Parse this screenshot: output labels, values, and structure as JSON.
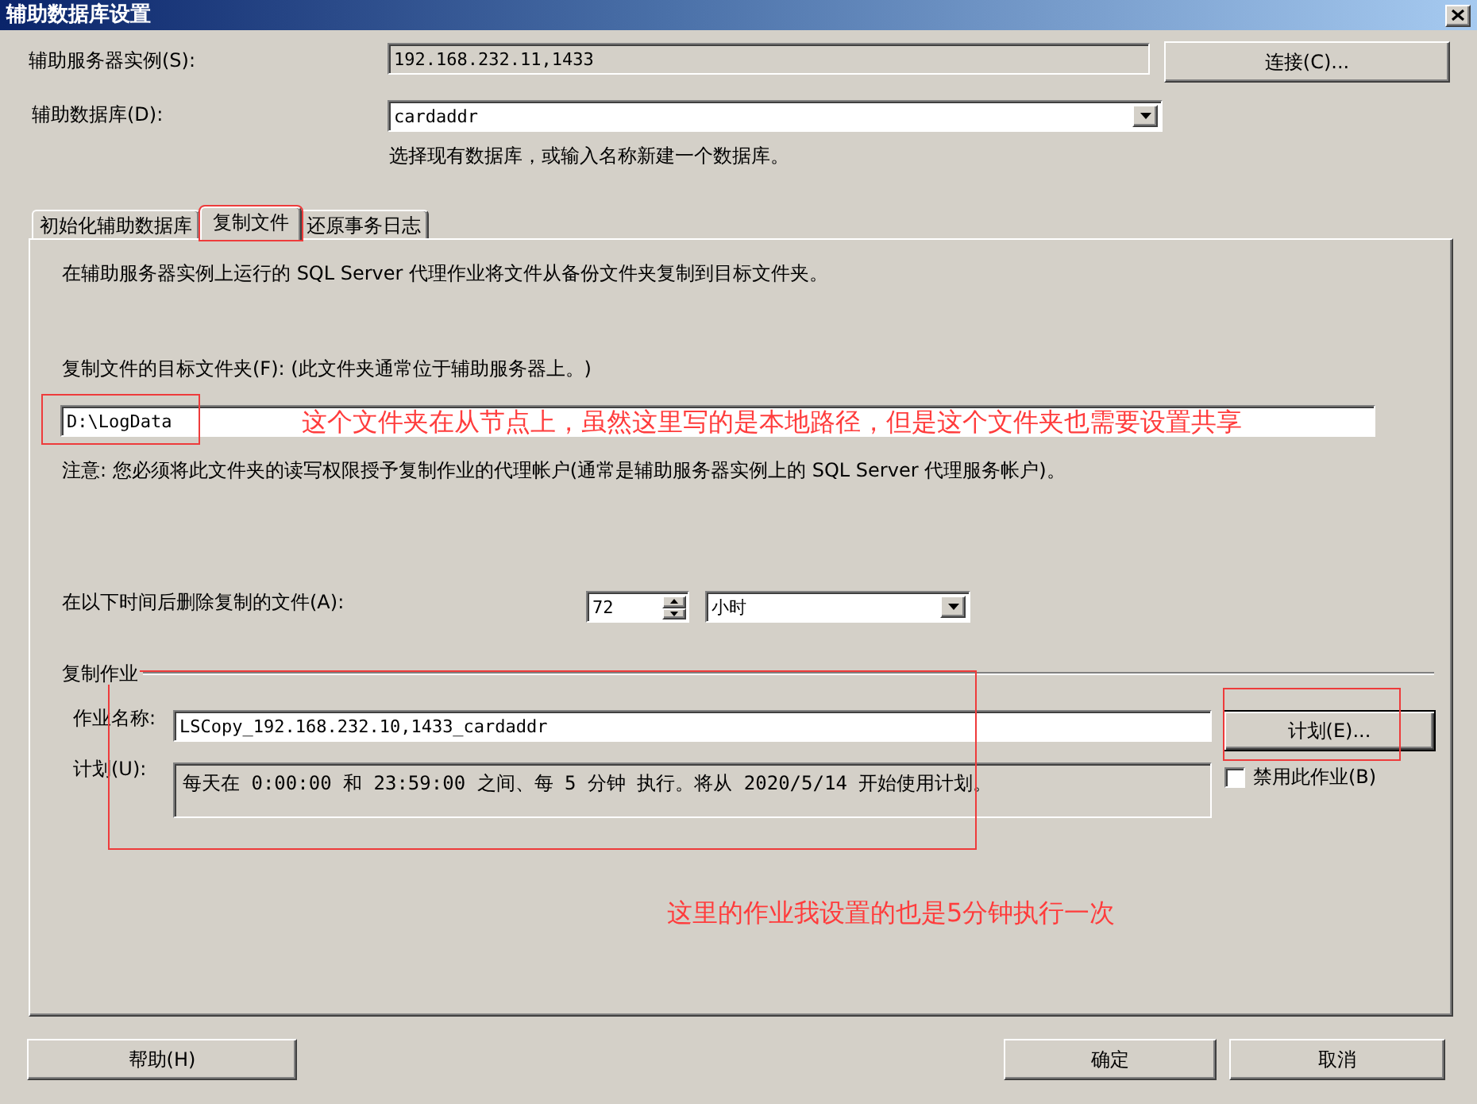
{
  "window": {
    "title": "辅助数据库设置"
  },
  "secondary_server": {
    "label": "辅助服务器实例(S):",
    "value": "192.168.232.11,1433",
    "disabled": true,
    "connect_button": "连接(C)..."
  },
  "secondary_database": {
    "label": "辅助数据库(D):",
    "value": "cardaddr",
    "hint": "选择现有数据库，或输入名称新建一个数据库。"
  },
  "tabs": [
    {
      "label": "初始化辅助数据库",
      "selected": false,
      "highlighted": false
    },
    {
      "label": "复制文件",
      "selected": true,
      "highlighted": true
    },
    {
      "label": "还原事务日志",
      "selected": false,
      "highlighted": false
    }
  ],
  "copy_files": {
    "description": "在辅助服务器实例上运行的 SQL Server 代理作业将文件从备份文件夹复制到目标文件夹。",
    "destination": {
      "label": "复制文件的目标文件夹(F): (此文件夹通常位于辅助服务器上。)",
      "value": "D:\\LogData",
      "highlighted": true,
      "annotation": "这个文件夹在从节点上，虽然这里写的是本地路径，但是这个文件夹也需要设置共享"
    },
    "note": "注意: 您必须将此文件夹的读写权限授予复制作业的代理帐户(通常是辅助服务器实例上的 SQL Server 代理服务帐户)。",
    "delete_after": {
      "label": "在以下时间后删除复制的文件(A):",
      "value": "72",
      "unit": "小时"
    },
    "job": {
      "title": "复制作业",
      "highlighted": true,
      "annotation": "这里的作业我设置的也是5分钟执行一次",
      "name_label": "作业名称:",
      "name_value": "LSCopy_192.168.232.10,1433_cardaddr",
      "schedule_button": {
        "label": "计划(E)...",
        "default": true,
        "highlighted": true
      },
      "schedule_label": "计划(U):",
      "schedule_text": "每天在 0:00:00 和 23:59:00 之间、每 5 分钟 执行。将从 2020/5/14 开始使用计划。",
      "disable_job": {
        "label": "禁用此作业(B)",
        "checked": false
      }
    }
  },
  "footer": {
    "left_buttons": [
      "帮助(H)"
    ],
    "right_buttons": [
      "确定",
      "取消"
    ]
  }
}
